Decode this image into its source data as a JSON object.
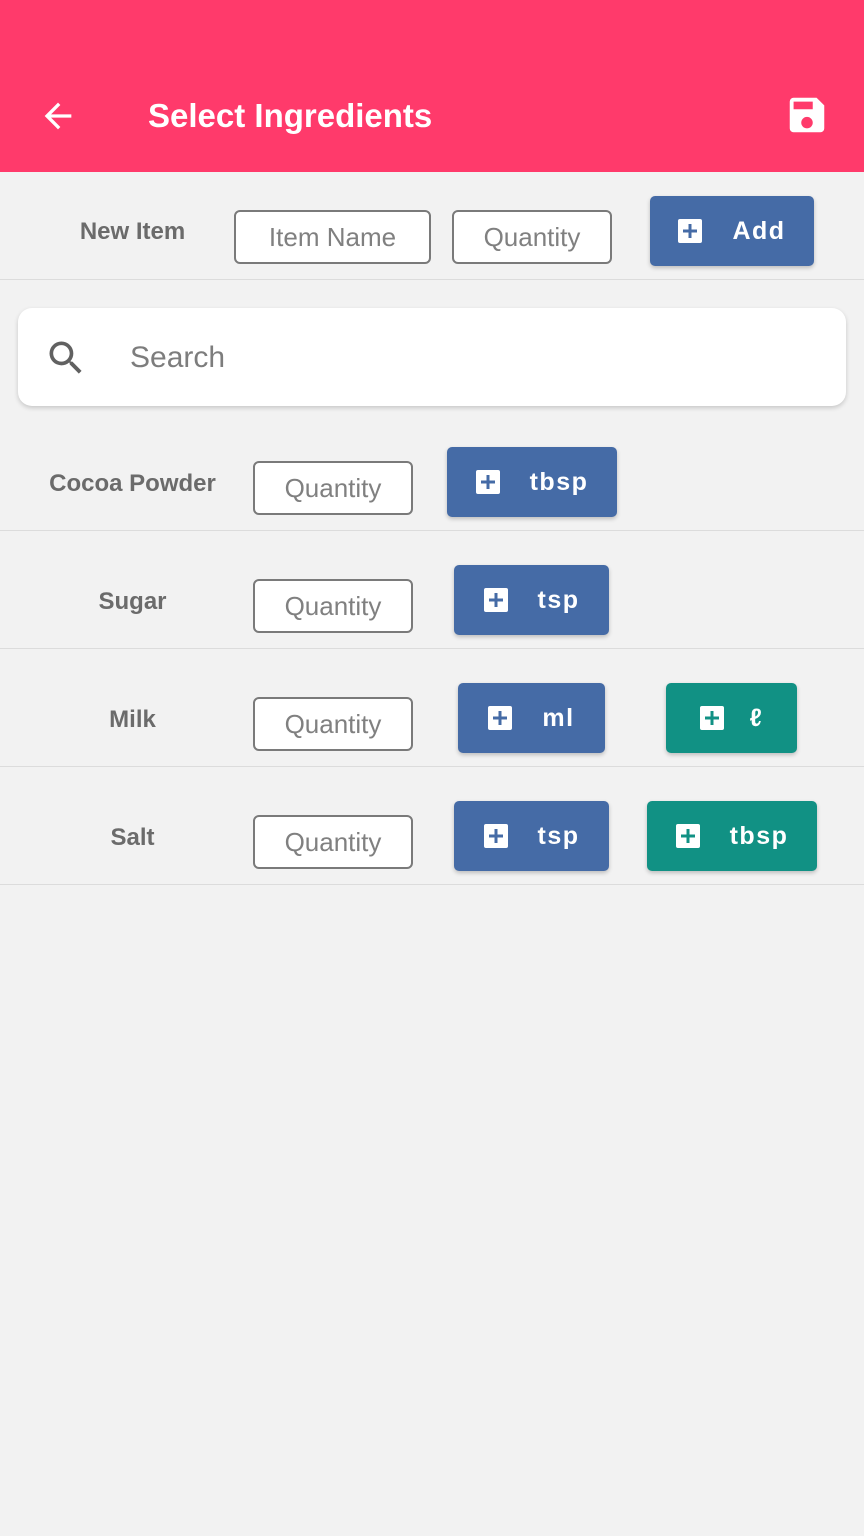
{
  "header": {
    "title": "Select Ingredients",
    "back_icon": "arrow-left-icon",
    "save_icon": "floppy-disk-icon",
    "background": "#ff3a6b"
  },
  "new_item": {
    "label": "New Item",
    "item_name_placeholder": "Item Name",
    "quantity_placeholder": "Quantity",
    "add_label": "Add"
  },
  "search": {
    "placeholder": "Search",
    "icon": "search-icon"
  },
  "ingredients": [
    {
      "name": "Cocoa Powder",
      "quantity_placeholder": "Quantity",
      "units": [
        {
          "label": "tbsp",
          "color": "#456ba6"
        }
      ]
    },
    {
      "name": "Sugar",
      "quantity_placeholder": "Quantity",
      "units": [
        {
          "label": "tsp",
          "color": "#456ba6"
        }
      ]
    },
    {
      "name": "Milk",
      "quantity_placeholder": "Quantity",
      "units": [
        {
          "label": "ml",
          "color": "#456ba6"
        },
        {
          "label": "ℓ",
          "color": "#119184"
        }
      ]
    },
    {
      "name": "Salt",
      "quantity_placeholder": "Quantity",
      "units": [
        {
          "label": "tsp",
          "color": "#456ba6"
        },
        {
          "label": "tbsp",
          "color": "#119184"
        }
      ]
    }
  ],
  "colors": {
    "primary_button": "#456ba6",
    "secondary_button": "#119184",
    "background": "#f2f2f2"
  }
}
